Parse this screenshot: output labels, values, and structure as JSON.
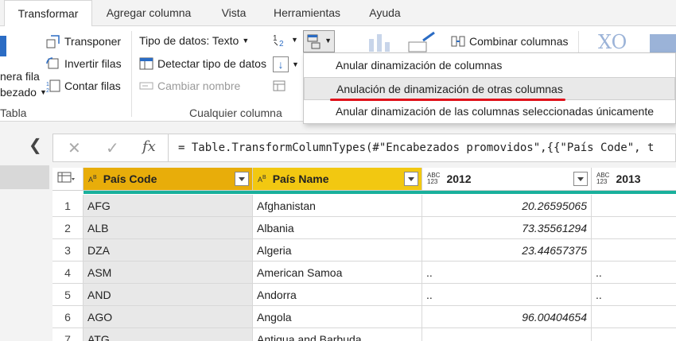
{
  "tabs": [
    {
      "label": "Transformar",
      "active": true
    },
    {
      "label": "Agregar columna",
      "active": false
    },
    {
      "label": "Vista",
      "active": false
    },
    {
      "label": "Herramientas",
      "active": false
    },
    {
      "label": "Ayuda",
      "active": false
    }
  ],
  "ribbon": {
    "table_group": {
      "partial_top": "nera fila",
      "partial_bottom": "bezado",
      "label": "Tabla",
      "transpose": "Transponer",
      "reverse_rows": "Invertir filas",
      "count_rows": "Contar filas"
    },
    "any_column": {
      "data_type": "Tipo de datos: Texto",
      "detect_type": "Detectar tipo de datos",
      "rename": "Cambiar nombre",
      "label": "Cualquier columna"
    },
    "merge_columns": "Combinar columnas",
    "sigma_symbol": "XO"
  },
  "unpivot_menu": {
    "items": [
      "Anular dinamización de columnas",
      "Anulación de dinamización de otras columnas",
      "Anular dinamización de las columnas seleccionadas únicamente"
    ],
    "highlighted_index": 1
  },
  "formula_bar": {
    "cancel_symbol": "✕",
    "confirm_symbol": "✓",
    "fx_label": "fx",
    "formula": "= Table.TransformColumnTypes(#\"Encabezados promovidos\",{{\"País Code\", t"
  },
  "grid": {
    "columns": [
      {
        "name": "País Code",
        "type_badge_top": "A",
        "type_badge_bottom": "B",
        "type": "text"
      },
      {
        "name": "País Name",
        "type_badge_top": "A",
        "type_badge_bottom": "B",
        "type": "text"
      },
      {
        "name": "2012",
        "type_badge_top": "ABC",
        "type_badge_bottom": "123",
        "type": "any"
      },
      {
        "name": "2013",
        "type_badge_top": "ABC",
        "type_badge_bottom": "123",
        "type": "any"
      }
    ],
    "rows": [
      {
        "n": "1",
        "code": "AFG",
        "name": "Afghanistan",
        "y2012": "20.26595065",
        "y2013": ""
      },
      {
        "n": "2",
        "code": "ALB",
        "name": "Albania",
        "y2012": "73.35561294",
        "y2013": ""
      },
      {
        "n": "3",
        "code": "DZA",
        "name": "Algeria",
        "y2012": "23.44657375",
        "y2013": ""
      },
      {
        "n": "4",
        "code": "ASM",
        "name": "American Samoa",
        "y2012": "..",
        "y2013": ".."
      },
      {
        "n": "5",
        "code": "AND",
        "name": "Andorra",
        "y2012": "..",
        "y2013": ".."
      },
      {
        "n": "6",
        "code": "AGO",
        "name": "Angola",
        "y2012": "96.00404654",
        "y2013": ""
      },
      {
        "n": "7",
        "code": "ATG",
        "name": "Antigua and Barbuda",
        "y2012": "",
        "y2013": ""
      }
    ]
  },
  "colors": {
    "accent_yellow": "#f2c811",
    "quality_bar": "#19b09c",
    "annotation_red": "#e0121b"
  }
}
